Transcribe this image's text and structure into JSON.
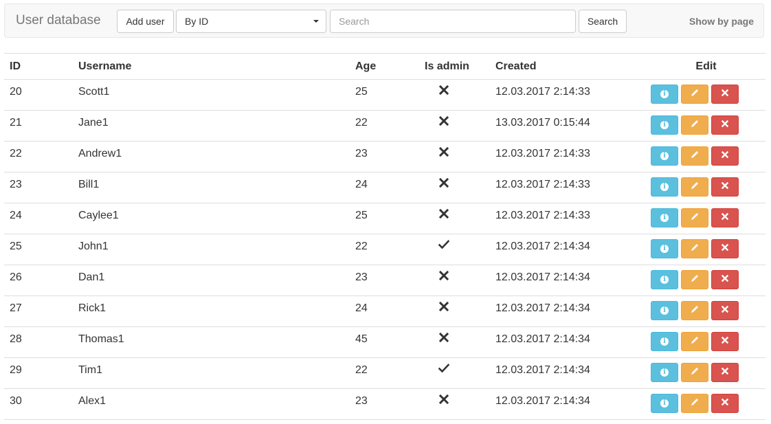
{
  "navbar": {
    "brand": "User database",
    "add_user_label": "Add user",
    "sort_select_value": "By ID",
    "search_placeholder": "Search",
    "search_button_label": "Search",
    "show_by_page_label": "Show by page"
  },
  "table": {
    "headers": {
      "id": "ID",
      "username": "Username",
      "age": "Age",
      "is_admin": "Is admin",
      "created": "Created",
      "edit": "Edit"
    },
    "rows": [
      {
        "id": "20",
        "username": "Scott1",
        "age": "25",
        "is_admin": false,
        "created": "12.03.2017 2:14:33"
      },
      {
        "id": "21",
        "username": "Jane1",
        "age": "22",
        "is_admin": false,
        "created": "13.03.2017 0:15:44"
      },
      {
        "id": "22",
        "username": "Andrew1",
        "age": "23",
        "is_admin": false,
        "created": "12.03.2017 2:14:33"
      },
      {
        "id": "23",
        "username": "Bill1",
        "age": "24",
        "is_admin": false,
        "created": "12.03.2017 2:14:33"
      },
      {
        "id": "24",
        "username": "Caylee1",
        "age": "25",
        "is_admin": false,
        "created": "12.03.2017 2:14:33"
      },
      {
        "id": "25",
        "username": "John1",
        "age": "22",
        "is_admin": true,
        "created": "12.03.2017 2:14:34"
      },
      {
        "id": "26",
        "username": "Dan1",
        "age": "23",
        "is_admin": false,
        "created": "12.03.2017 2:14:34"
      },
      {
        "id": "27",
        "username": "Rick1",
        "age": "24",
        "is_admin": false,
        "created": "12.03.2017 2:14:34"
      },
      {
        "id": "28",
        "username": "Thomas1",
        "age": "45",
        "is_admin": false,
        "created": "12.03.2017 2:14:34"
      },
      {
        "id": "29",
        "username": "Tim1",
        "age": "22",
        "is_admin": true,
        "created": "12.03.2017 2:14:34"
      },
      {
        "id": "30",
        "username": "Alex1",
        "age": "23",
        "is_admin": false,
        "created": "12.03.2017 2:14:34"
      }
    ]
  },
  "icons": {
    "admin_true": "check-icon",
    "admin_false": "cross-icon",
    "info": "info-icon",
    "edit": "pencil-icon",
    "delete": "remove-icon"
  },
  "colors": {
    "info": "#5bc0de",
    "warning": "#f0ad4e",
    "danger": "#d9534f"
  }
}
